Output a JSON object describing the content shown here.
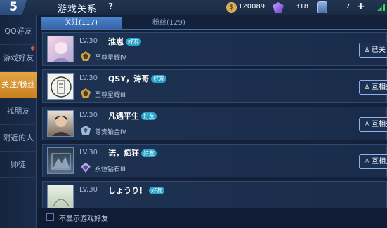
{
  "header": {
    "back_label": "5",
    "title": "游戏关系",
    "help": "?",
    "coins": "120089",
    "gems": "318",
    "tickets": "7",
    "plus": "+"
  },
  "sidebar": {
    "items": [
      {
        "label": "QQ好友"
      },
      {
        "label": "游戏好友"
      },
      {
        "label": "关注/粉丝"
      },
      {
        "label": "找朋友"
      },
      {
        "label": "附近的人"
      },
      {
        "label": "师徒"
      }
    ]
  },
  "tabs": [
    {
      "label": "关注(117)"
    },
    {
      "label": "粉丝(129)"
    }
  ],
  "rows": [
    {
      "level": "LV.30",
      "name": "淮崽",
      "badge": "好友",
      "rank": "至尊星耀IV",
      "button": "已关",
      "button_icon": "person-check-icon"
    },
    {
      "level": "LV.30",
      "name": "QSY，涛哥",
      "badge": "好友",
      "rank": "至尊星耀III",
      "button": "互相关",
      "button_icon": "person-check-icon"
    },
    {
      "level": "LV.30",
      "name": "凡遇平生",
      "badge": "好友",
      "rank": "尊贵铂金IV",
      "button": "互相关",
      "button_icon": "person-check-icon"
    },
    {
      "level": "LV.30",
      "name": "诺，痴狂",
      "badge": "好友",
      "rank": "永恒钻石III",
      "button": "互相关",
      "button_icon": "person-check-icon"
    },
    {
      "level": "LV.30",
      "name": "しょうり！",
      "badge": "好友",
      "rank": "",
      "button": "",
      "button_icon": ""
    }
  ],
  "footer": {
    "checkbox_label": "不显示游戏好友"
  },
  "colors": {
    "accent": "#3f6fb0",
    "active_sidebar": "#d9942f",
    "friend_badge": "#2aa3c9"
  }
}
